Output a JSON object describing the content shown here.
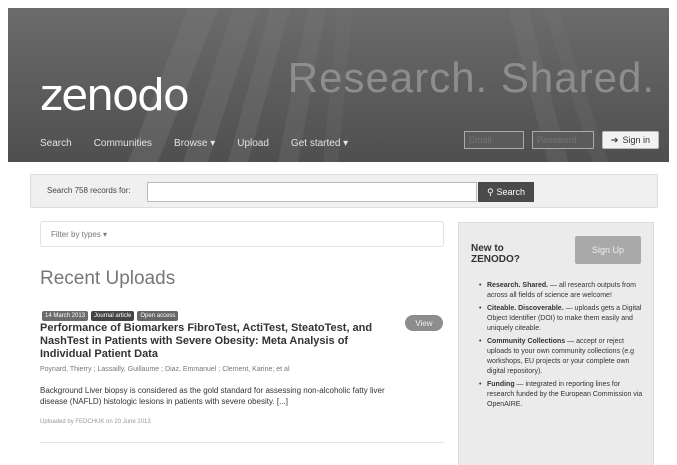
{
  "header": {
    "logo": "zenodo",
    "tagline": "Research. Shared.",
    "nav": [
      "Search",
      "Communities",
      "Browse",
      "Upload",
      "Get started"
    ],
    "email_placeholder": "Email",
    "password_placeholder": "Password",
    "signin_label": "Sign in"
  },
  "search": {
    "label": "Search 758 records for:",
    "button_label": "Search"
  },
  "filter": {
    "label": "Filter by types"
  },
  "recent": {
    "title": "Recent Uploads",
    "record": {
      "date_badge": "14 March 2013",
      "type_badge": "Journal article",
      "access_badge": "Open access",
      "title": "Performance of Biomarkers FibroTest, ActiTest, SteatoTest, and NashTest in Patients with Severe Obesity: Meta Analysis of Individual Patient Data",
      "authors": "Poynard, Thierry ; Lassailly, Guillaume ; Diaz, Emmanuel ; Clement, Karine; et al",
      "abstract": "Background Liver biopsy is considered as the gold standard for assessing non-alcoholic fatty liver disease (NAFLD) histologic lesions in patients with severe obesity. [...]",
      "uploaded": "Uploaded by FEDCHUK on 20 June 2013",
      "view_label": "View"
    }
  },
  "sidebar": {
    "title": "New to ZENODO?",
    "signup_label": "Sign Up",
    "items": [
      {
        "heading": "Research. Shared.",
        "text": " — all research outputs from across all fields of science are welcome!"
      },
      {
        "heading": "Citeable. Discoverable.",
        "text": " — uploads gets a Digital Object Identifier (DOI) to make them easily and uniquely citeable."
      },
      {
        "heading": "Community Collections",
        "text": " — accept or reject uploads to your own community collections (e.g workshops, EU projects or your complete own digital repository)."
      },
      {
        "heading": "Funding",
        "text": " — integrated in reporting lines for research funded by the European Commission via OpenAIRE."
      }
    ]
  },
  "colors": {
    "header_bg": "#5e5e5e",
    "search_button": "#4a4a4a",
    "view_button": "#8d8d8d",
    "sidebar_bg": "#ebebeb"
  }
}
